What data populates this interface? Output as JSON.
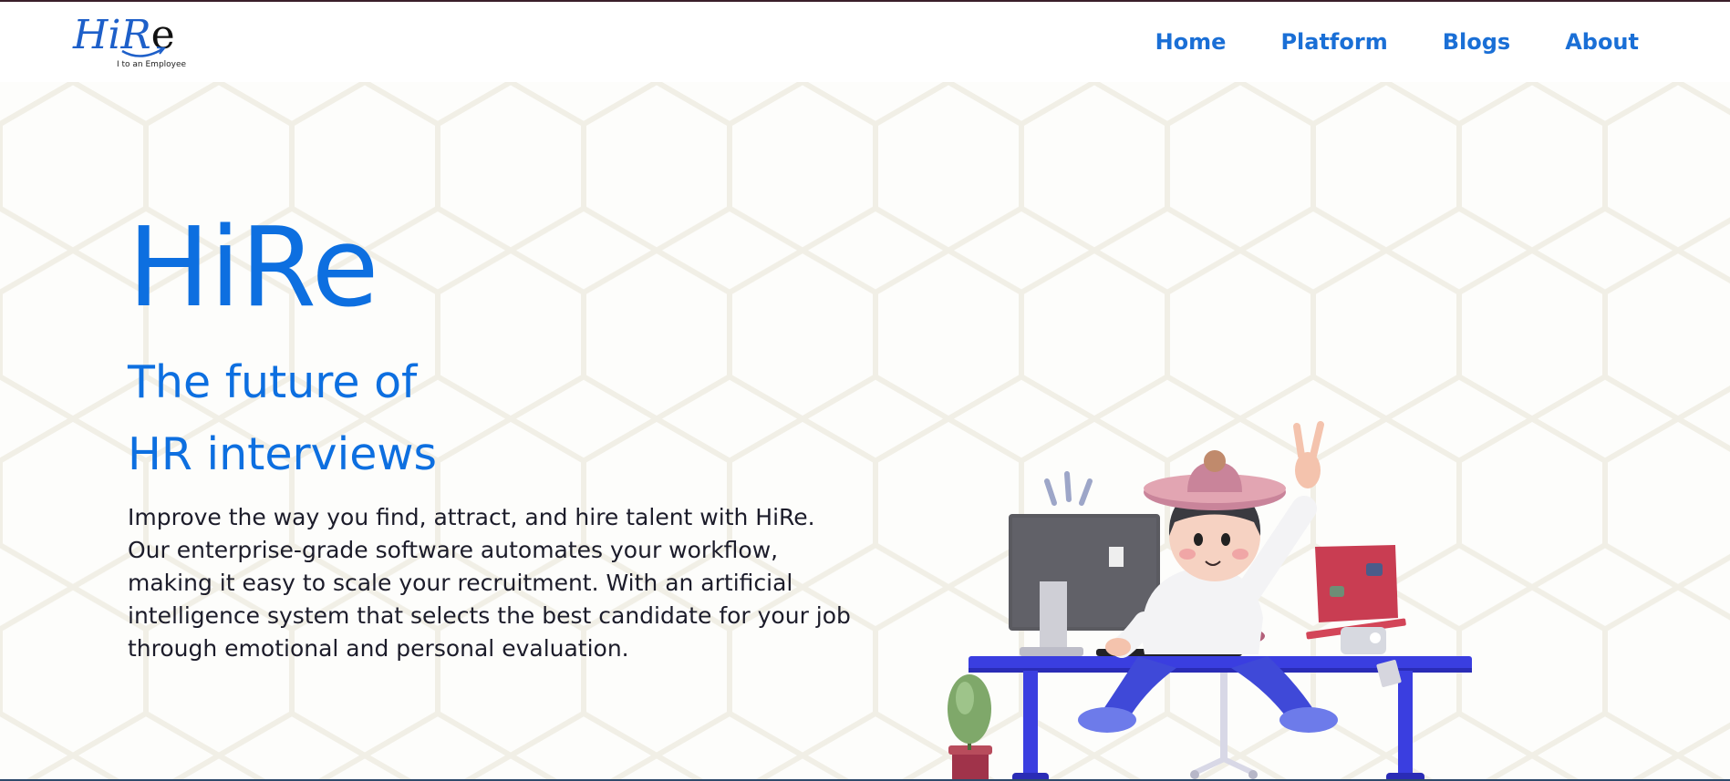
{
  "logo": {
    "mark_part1": "H",
    "mark_part2": "i",
    "mark_part3": "R",
    "mark_part4": "e",
    "tagline": "I to an Employee"
  },
  "nav": {
    "items": [
      {
        "label": "Home"
      },
      {
        "label": "Platform"
      },
      {
        "label": "Blogs"
      },
      {
        "label": "About"
      }
    ]
  },
  "hero": {
    "title": "HiRe",
    "subtitle_line1": "The future of",
    "subtitle_line2": "HR interviews",
    "description": "Improve the way you find, attract, and hire talent with HiRe. Our enterprise-grade software automates your workflow, making it easy to scale your recruitment. With an artificial intelligence system that selects the best candidate for your job through emotional and personal evaluation."
  },
  "colors": {
    "brand_blue": "#0d6fe0",
    "nav_blue": "#1a6fd6",
    "text_dark": "#1c1c2a",
    "desk_blue": "#3a3ee0"
  }
}
